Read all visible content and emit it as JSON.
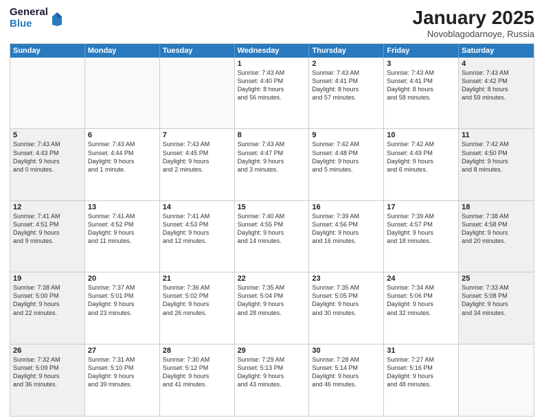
{
  "logo": {
    "general": "General",
    "blue": "Blue"
  },
  "header": {
    "month": "January 2025",
    "location": "Novoblagodarnoye, Russia"
  },
  "days": [
    "Sunday",
    "Monday",
    "Tuesday",
    "Wednesday",
    "Thursday",
    "Friday",
    "Saturday"
  ],
  "weeks": [
    [
      {
        "day": "",
        "content": []
      },
      {
        "day": "",
        "content": []
      },
      {
        "day": "",
        "content": []
      },
      {
        "day": "1",
        "content": [
          "Sunrise: 7:43 AM",
          "Sunset: 4:40 PM",
          "Daylight: 8 hours",
          "and 56 minutes."
        ]
      },
      {
        "day": "2",
        "content": [
          "Sunrise: 7:43 AM",
          "Sunset: 4:41 PM",
          "Daylight: 8 hours",
          "and 57 minutes."
        ]
      },
      {
        "day": "3",
        "content": [
          "Sunrise: 7:43 AM",
          "Sunset: 4:41 PM",
          "Daylight: 8 hours",
          "and 58 minutes."
        ]
      },
      {
        "day": "4",
        "content": [
          "Sunrise: 7:43 AM",
          "Sunset: 4:42 PM",
          "Daylight: 8 hours",
          "and 59 minutes."
        ]
      }
    ],
    [
      {
        "day": "5",
        "content": [
          "Sunrise: 7:43 AM",
          "Sunset: 4:43 PM",
          "Daylight: 9 hours",
          "and 0 minutes."
        ]
      },
      {
        "day": "6",
        "content": [
          "Sunrise: 7:43 AM",
          "Sunset: 4:44 PM",
          "Daylight: 9 hours",
          "and 1 minute."
        ]
      },
      {
        "day": "7",
        "content": [
          "Sunrise: 7:43 AM",
          "Sunset: 4:45 PM",
          "Daylight: 9 hours",
          "and 2 minutes."
        ]
      },
      {
        "day": "8",
        "content": [
          "Sunrise: 7:43 AM",
          "Sunset: 4:47 PM",
          "Daylight: 9 hours",
          "and 3 minutes."
        ]
      },
      {
        "day": "9",
        "content": [
          "Sunrise: 7:42 AM",
          "Sunset: 4:48 PM",
          "Daylight: 9 hours",
          "and 5 minutes."
        ]
      },
      {
        "day": "10",
        "content": [
          "Sunrise: 7:42 AM",
          "Sunset: 4:49 PM",
          "Daylight: 9 hours",
          "and 6 minutes."
        ]
      },
      {
        "day": "11",
        "content": [
          "Sunrise: 7:42 AM",
          "Sunset: 4:50 PM",
          "Daylight: 9 hours",
          "and 8 minutes."
        ]
      }
    ],
    [
      {
        "day": "12",
        "content": [
          "Sunrise: 7:41 AM",
          "Sunset: 4:51 PM",
          "Daylight: 9 hours",
          "and 9 minutes."
        ]
      },
      {
        "day": "13",
        "content": [
          "Sunrise: 7:41 AM",
          "Sunset: 4:52 PM",
          "Daylight: 9 hours",
          "and 11 minutes."
        ]
      },
      {
        "day": "14",
        "content": [
          "Sunrise: 7:41 AM",
          "Sunset: 4:53 PM",
          "Daylight: 9 hours",
          "and 12 minutes."
        ]
      },
      {
        "day": "15",
        "content": [
          "Sunrise: 7:40 AM",
          "Sunset: 4:55 PM",
          "Daylight: 9 hours",
          "and 14 minutes."
        ]
      },
      {
        "day": "16",
        "content": [
          "Sunrise: 7:39 AM",
          "Sunset: 4:56 PM",
          "Daylight: 9 hours",
          "and 16 minutes."
        ]
      },
      {
        "day": "17",
        "content": [
          "Sunrise: 7:39 AM",
          "Sunset: 4:57 PM",
          "Daylight: 9 hours",
          "and 18 minutes."
        ]
      },
      {
        "day": "18",
        "content": [
          "Sunrise: 7:38 AM",
          "Sunset: 4:58 PM",
          "Daylight: 9 hours",
          "and 20 minutes."
        ]
      }
    ],
    [
      {
        "day": "19",
        "content": [
          "Sunrise: 7:38 AM",
          "Sunset: 5:00 PM",
          "Daylight: 9 hours",
          "and 22 minutes."
        ]
      },
      {
        "day": "20",
        "content": [
          "Sunrise: 7:37 AM",
          "Sunset: 5:01 PM",
          "Daylight: 9 hours",
          "and 23 minutes."
        ]
      },
      {
        "day": "21",
        "content": [
          "Sunrise: 7:36 AM",
          "Sunset: 5:02 PM",
          "Daylight: 9 hours",
          "and 26 minutes."
        ]
      },
      {
        "day": "22",
        "content": [
          "Sunrise: 7:35 AM",
          "Sunset: 5:04 PM",
          "Daylight: 9 hours",
          "and 28 minutes."
        ]
      },
      {
        "day": "23",
        "content": [
          "Sunrise: 7:35 AM",
          "Sunset: 5:05 PM",
          "Daylight: 9 hours",
          "and 30 minutes."
        ]
      },
      {
        "day": "24",
        "content": [
          "Sunrise: 7:34 AM",
          "Sunset: 5:06 PM",
          "Daylight: 9 hours",
          "and 32 minutes."
        ]
      },
      {
        "day": "25",
        "content": [
          "Sunrise: 7:33 AM",
          "Sunset: 5:08 PM",
          "Daylight: 9 hours",
          "and 34 minutes."
        ]
      }
    ],
    [
      {
        "day": "26",
        "content": [
          "Sunrise: 7:32 AM",
          "Sunset: 5:09 PM",
          "Daylight: 9 hours",
          "and 36 minutes."
        ]
      },
      {
        "day": "27",
        "content": [
          "Sunrise: 7:31 AM",
          "Sunset: 5:10 PM",
          "Daylight: 9 hours",
          "and 39 minutes."
        ]
      },
      {
        "day": "28",
        "content": [
          "Sunrise: 7:30 AM",
          "Sunset: 5:12 PM",
          "Daylight: 9 hours",
          "and 41 minutes."
        ]
      },
      {
        "day": "29",
        "content": [
          "Sunrise: 7:29 AM",
          "Sunset: 5:13 PM",
          "Daylight: 9 hours",
          "and 43 minutes."
        ]
      },
      {
        "day": "30",
        "content": [
          "Sunrise: 7:28 AM",
          "Sunset: 5:14 PM",
          "Daylight: 9 hours",
          "and 46 minutes."
        ]
      },
      {
        "day": "31",
        "content": [
          "Sunrise: 7:27 AM",
          "Sunset: 5:16 PM",
          "Daylight: 9 hours",
          "and 48 minutes."
        ]
      },
      {
        "day": "",
        "content": []
      }
    ]
  ]
}
